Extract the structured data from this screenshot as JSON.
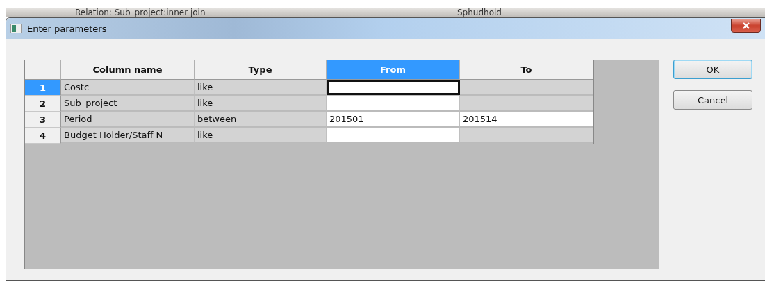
{
  "background_window": {
    "texts": [
      "Relation: Sub_project:inner join",
      "Sphudhold"
    ]
  },
  "window": {
    "title": "Enter parameters"
  },
  "table": {
    "columns": [
      {
        "label": "Column name",
        "selected": false
      },
      {
        "label": "Type",
        "selected": false
      },
      {
        "label": "From",
        "selected": true
      },
      {
        "label": "To",
        "selected": false
      }
    ],
    "rows": [
      {
        "number": "1",
        "selected": true,
        "name": "Costc",
        "type": "like",
        "from": {
          "editable": true,
          "focused": true
        },
        "to": {
          "editable": false,
          "focused": false
        }
      },
      {
        "number": "2",
        "selected": false,
        "name": "Sub_project",
        "type": "like",
        "from": {
          "editable": true,
          "focused": false
        },
        "to": {
          "editable": false,
          "focused": false
        }
      },
      {
        "number": "3",
        "selected": false,
        "name": "Period",
        "type": "between",
        "from": {
          "value": "201501",
          "editable": true,
          "focused": false
        },
        "to": {
          "value": "201514",
          "editable": true,
          "focused": false
        }
      },
      {
        "number": "4",
        "selected": false,
        "name": "Budget Holder/Staff N",
        "type": "like",
        "from": {
          "editable": true,
          "focused": false
        },
        "to": {
          "editable": false,
          "focused": false
        }
      }
    ]
  },
  "buttons": [
    {
      "label": "OK",
      "default": true
    },
    {
      "label": "Cancel",
      "default": false
    }
  ]
}
